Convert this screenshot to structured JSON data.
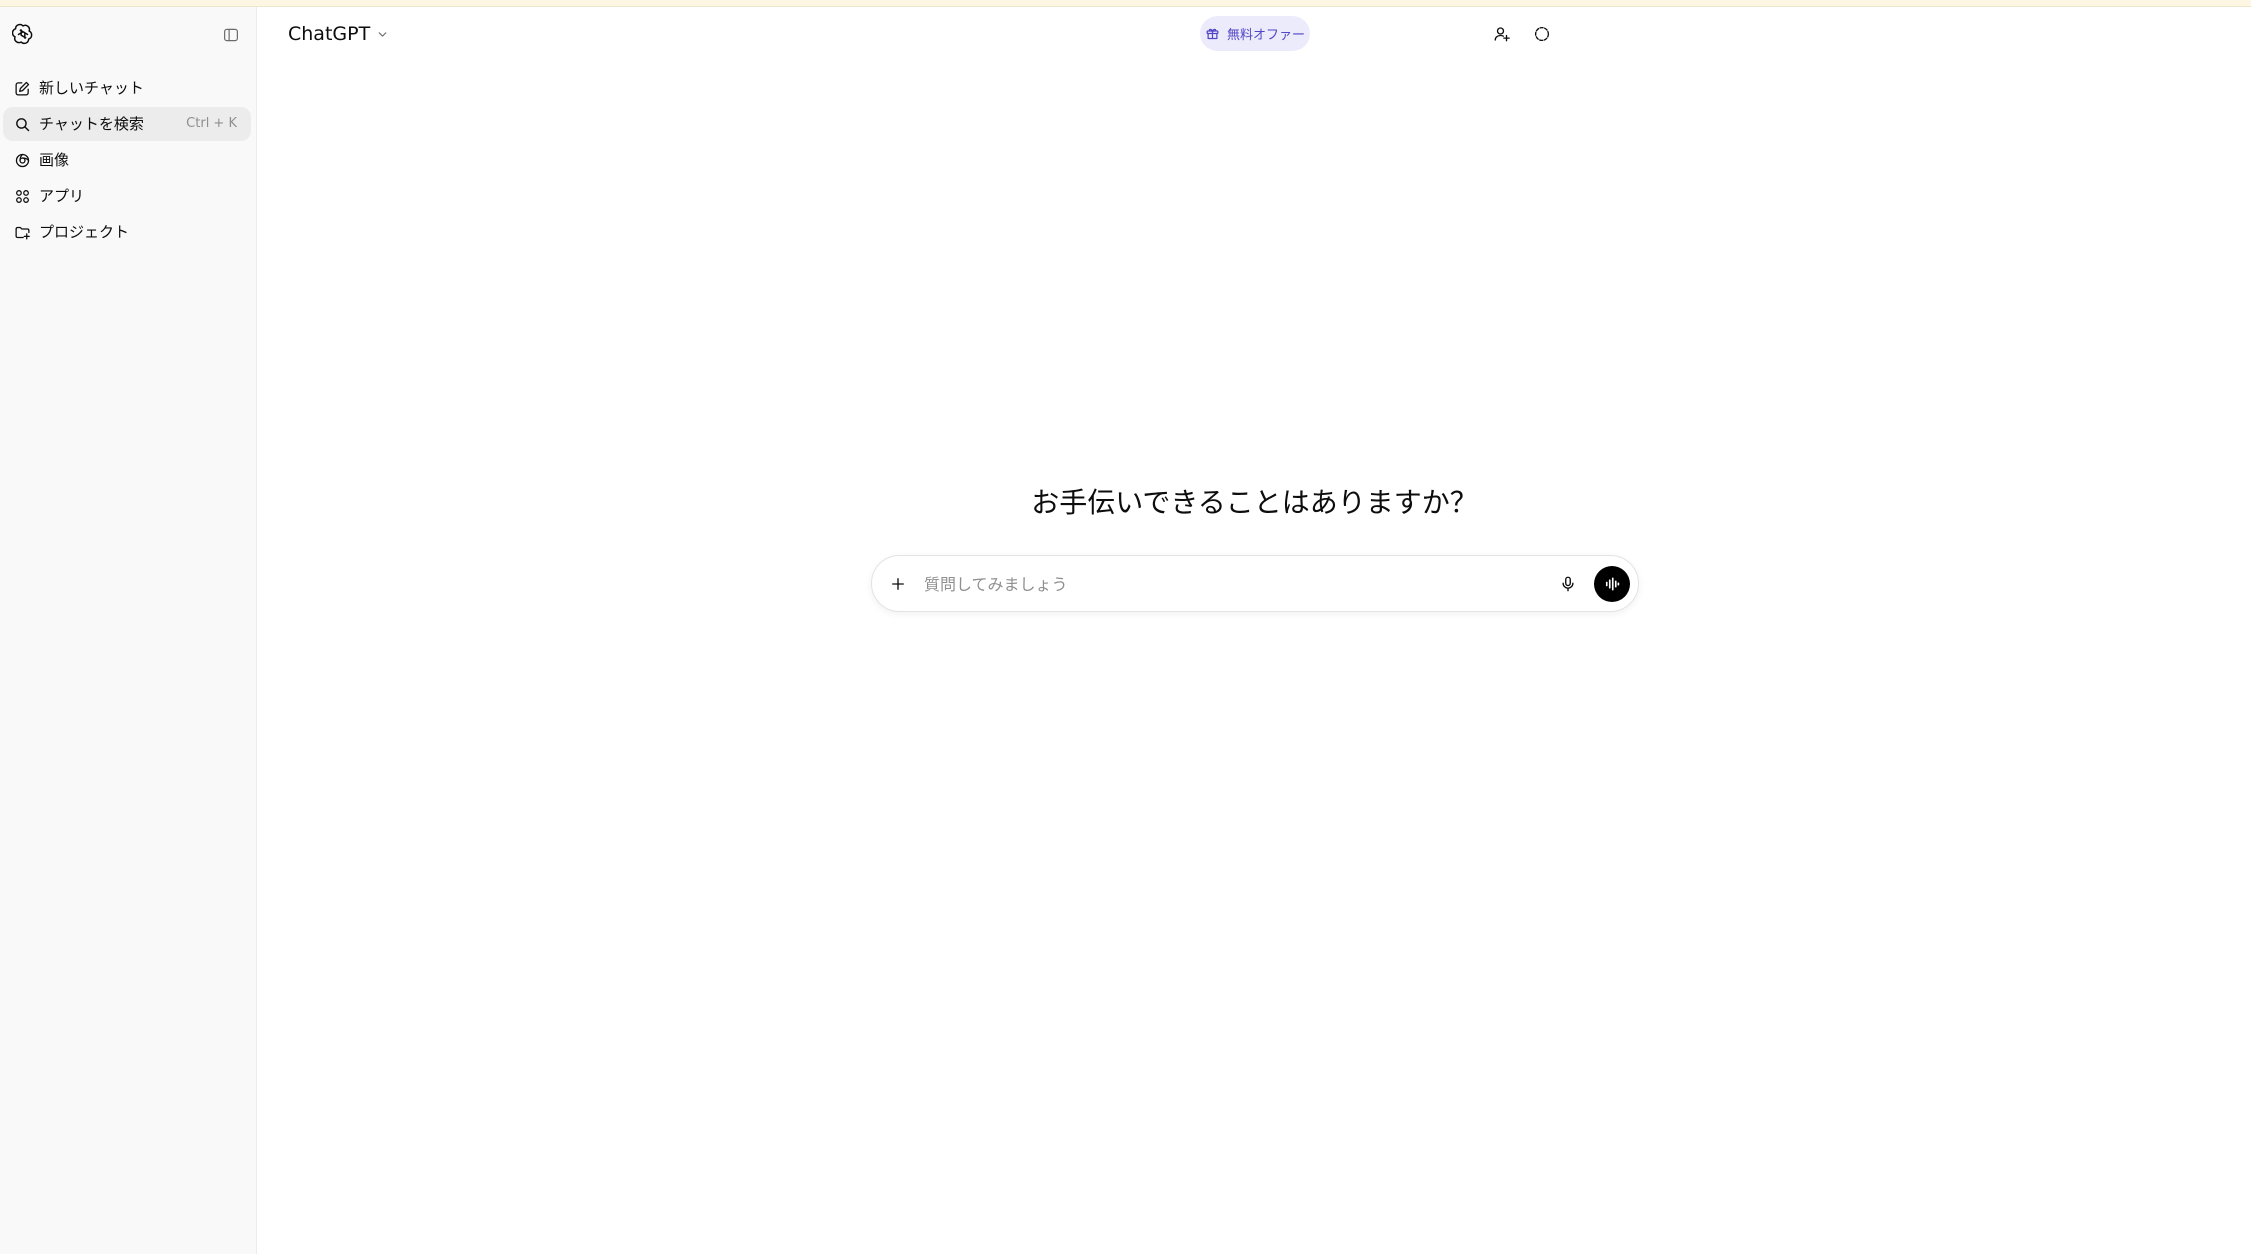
{
  "sidebar": {
    "items": [
      {
        "label": "新しいチャット",
        "icon": "edit-icon"
      },
      {
        "label": "チャットを検索",
        "icon": "search-icon",
        "shortcut": "Ctrl + K"
      },
      {
        "label": "画像",
        "icon": "image-icon"
      },
      {
        "label": "アプリ",
        "icon": "apps-icon"
      },
      {
        "label": "プロジェクト",
        "icon": "folder-icon"
      }
    ]
  },
  "header": {
    "model": "ChatGPT",
    "offer": "無料オファー"
  },
  "main": {
    "greeting": "お手伝いできることはありますか？",
    "composer": {
      "placeholder": "質問してみましょう"
    }
  },
  "colors": {
    "accent": "#5146c5",
    "offer_bg": "#ecebfb",
    "sidebar_bg": "#f9f9f9"
  }
}
